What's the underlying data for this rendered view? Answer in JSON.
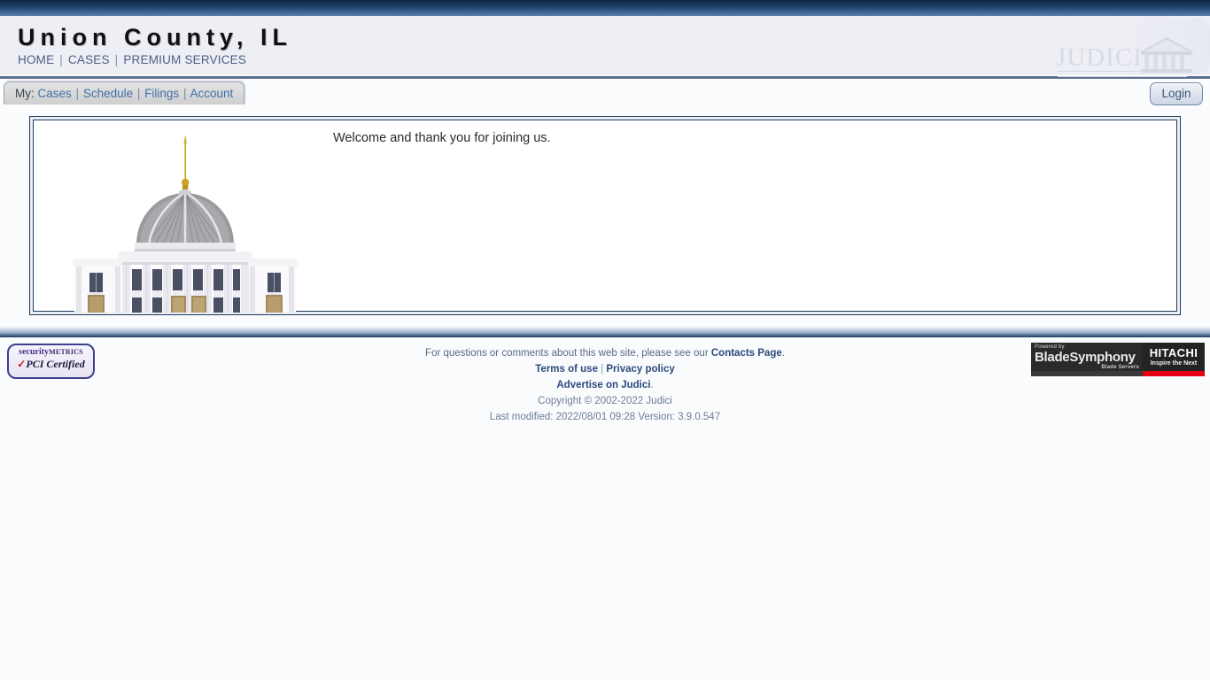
{
  "header": {
    "site_title": "Union County, IL",
    "nav": [
      {
        "label": "HOME"
      },
      {
        "label": "CASES"
      },
      {
        "label": "PREMIUM SERVICES"
      }
    ],
    "separator": "|",
    "logo": {
      "wordmark": "JUDICI",
      "icon": "courthouse-temple-icon"
    }
  },
  "navbar": {
    "my_label": "My:",
    "items": [
      {
        "label": "Cases"
      },
      {
        "label": "Schedule"
      },
      {
        "label": "Filings"
      },
      {
        "label": "Account"
      }
    ],
    "separator": "|",
    "login_label": "Login"
  },
  "main": {
    "welcome_message": "Welcome and thank you for joining us.",
    "illustration": "courthouse-building-illustration"
  },
  "footer": {
    "questions_prefix": "For questions or comments about this web site, please see our ",
    "contacts_link": "Contacts Page",
    "questions_suffix": ".",
    "terms_link": "Terms of use",
    "privacy_link": "Privacy policy",
    "link_separator": "|",
    "advertise_link": "Advertise on Judici",
    "advertise_suffix": ".",
    "copyright": "Copyright © 2002-2022 Judici",
    "last_modified": "Last modified: 2022/08/01 09:28 Version: 3.9.0.547",
    "pci_badge": {
      "security": "security",
      "metrics": "METRICS",
      "check": "✓",
      "certified": "PCI Certified"
    },
    "blade_banner": {
      "powered_by": "Powered by",
      "product": "BladeSymphony",
      "product_sub": "Blade Servers",
      "brand": "HITACHI",
      "tagline": "Inspire the Next"
    }
  },
  "colors": {
    "top_strip_dark": "#12263f",
    "top_strip_light": "#5c80ac",
    "header_bg": "#eeeef5",
    "link_blue": "#3f6fa8",
    "footer_link": "#2b4a7d",
    "frame_border": "#1f3a5f",
    "hitachi_red": "#e60012",
    "pci_purple": "#4a2f8f"
  }
}
